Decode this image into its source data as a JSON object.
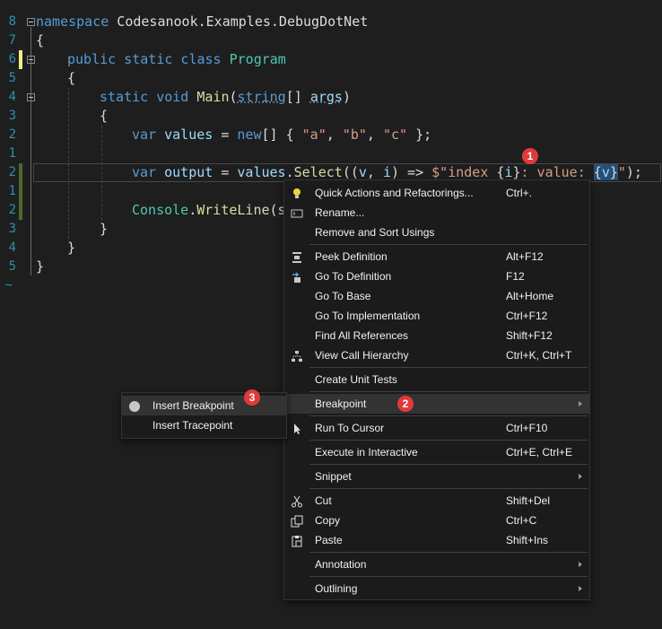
{
  "editor": {
    "line_numbers": [
      "8",
      "7",
      "6",
      "5",
      "4",
      "3",
      "2",
      "1",
      "2",
      "1",
      "2",
      "3",
      "4",
      "5",
      "~"
    ],
    "lines": {
      "l1": {
        "ns_kw": "namespace",
        "ns_name": " Codesanook.Examples.DebugDotNet"
      },
      "l2": {
        "text": "{"
      },
      "l3": {
        "kw": "public static class",
        "name": "Program"
      },
      "l4": {
        "text": "{"
      },
      "l5": {
        "kw": "static void",
        "fn": "Main",
        "p1": "(",
        "ty": "string",
        "p2": "[] ",
        "arg": "args",
        "p3": ")"
      },
      "l6": {
        "text": "{"
      },
      "l7": {
        "kw": "var",
        "var": "values",
        "eq": " = ",
        "new": "new",
        "p1": "[] { ",
        "s1": "\"a\"",
        "c1": ", ",
        "s2": "\"b\"",
        "c2": ", ",
        "s3": "\"c\"",
        "p2": " };"
      },
      "l8": {
        "kw": "var",
        "var": "output",
        "eq": " = ",
        "obj": "values",
        "dot": ".",
        "fn": "Select",
        "p1": "((",
        "a1": "v",
        "c1": ", ",
        "a2": "i",
        "p2": ") => ",
        "str1": "$\"index ",
        "b1": "{",
        "i1": "i",
        "b2": "}",
        "str2": ": value: ",
        "b3": "{",
        "v1": "v",
        "b4": "}",
        "str3": "\"",
        "p3": ");"
      },
      "l9": {
        "ty": "Console",
        "dot": ".",
        "fn": "WriteLine",
        "p1": "(s"
      },
      "l10": {
        "text": "}"
      },
      "l11": {
        "text": "}"
      },
      "l12": {
        "text": "}"
      }
    }
  },
  "context_menu": {
    "items": [
      {
        "label": "Quick Actions and Refactorings...",
        "shortcut": "Ctrl+."
      },
      {
        "label": "Rename...",
        "shortcut": ""
      },
      {
        "label": "Remove and Sort Usings",
        "shortcut": ""
      },
      {
        "label": "Peek Definition",
        "shortcut": "Alt+F12"
      },
      {
        "label": "Go To Definition",
        "shortcut": "F12"
      },
      {
        "label": "Go To Base",
        "shortcut": "Alt+Home"
      },
      {
        "label": "Go To Implementation",
        "shortcut": "Ctrl+F12"
      },
      {
        "label": "Find All References",
        "shortcut": "Shift+F12"
      },
      {
        "label": "View Call Hierarchy",
        "shortcut": "Ctrl+K, Ctrl+T"
      },
      {
        "label": "Create Unit Tests",
        "shortcut": ""
      },
      {
        "label": "Breakpoint",
        "shortcut": ""
      },
      {
        "label": "Run To Cursor",
        "shortcut": "Ctrl+F10"
      },
      {
        "label": "Execute in Interactive",
        "shortcut": "Ctrl+E, Ctrl+E"
      },
      {
        "label": "Snippet",
        "shortcut": ""
      },
      {
        "label": "Cut",
        "shortcut": "Shift+Del"
      },
      {
        "label": "Copy",
        "shortcut": "Ctrl+C"
      },
      {
        "label": "Paste",
        "shortcut": "Shift+Ins"
      },
      {
        "label": "Annotation",
        "shortcut": ""
      },
      {
        "label": "Outlining",
        "shortcut": ""
      }
    ]
  },
  "submenu": {
    "items": [
      {
        "label": "Insert Breakpoint"
      },
      {
        "label": "Insert Tracepoint"
      }
    ]
  },
  "badges": {
    "b1": "1",
    "b2": "2",
    "b3": "3"
  },
  "colors": {
    "accent_badge": "#e03a3a",
    "menu_bg": "#1b1b1c",
    "editor_bg": "#1e1e1e"
  }
}
